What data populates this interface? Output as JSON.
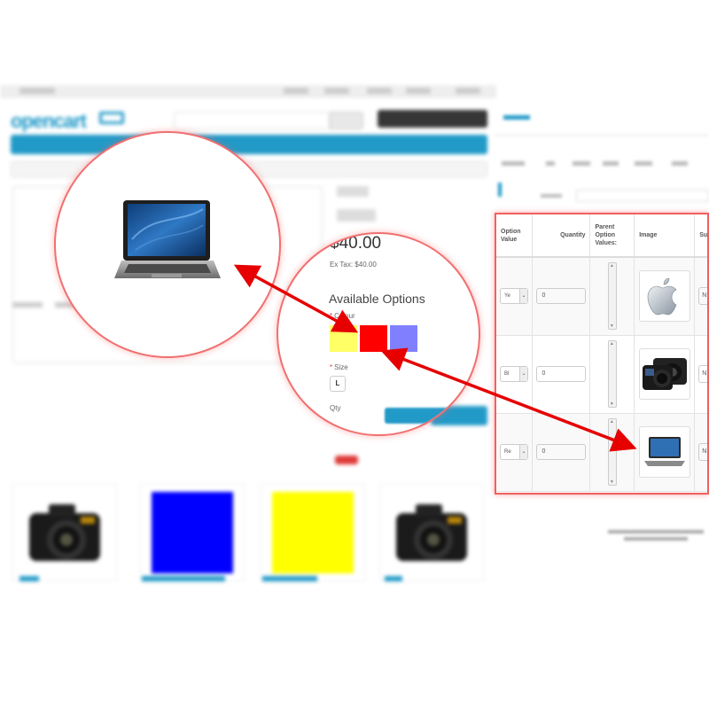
{
  "colors": {
    "brand_blue": "#229ac8",
    "arrow_red": "#e60000",
    "circle_border": "#f07070",
    "swatch_yellow": "#ffff66",
    "swatch_red": "#ff0000",
    "swatch_blue": "#8080ff",
    "thumb_blue": "#0000ff",
    "thumb_yellow": "#ffff00"
  },
  "zoom_options": {
    "price": "$40.00",
    "ex_tax": "Ex Tax: $40.00",
    "available_options": "Available Options",
    "colour_label": "Colour",
    "size_label": "Size",
    "size_value": "L",
    "qty_label": "Qty"
  },
  "admin_table": {
    "headers": {
      "option_value": "Option Value",
      "quantity": "Quantity",
      "parent": "Parent Option Values:",
      "image": "Image",
      "subtract": "Subt Stoc"
    },
    "rows": [
      {
        "option": "Ye",
        "quantity": "0",
        "image_icon": "apple-logo-icon",
        "subtract": "N"
      },
      {
        "option": "Bl",
        "quantity": "0",
        "image_icon": "camera-icon",
        "subtract": "N"
      },
      {
        "option": "Re",
        "quantity": "0",
        "image_icon": "laptop-icon",
        "subtract": "N"
      }
    ]
  }
}
